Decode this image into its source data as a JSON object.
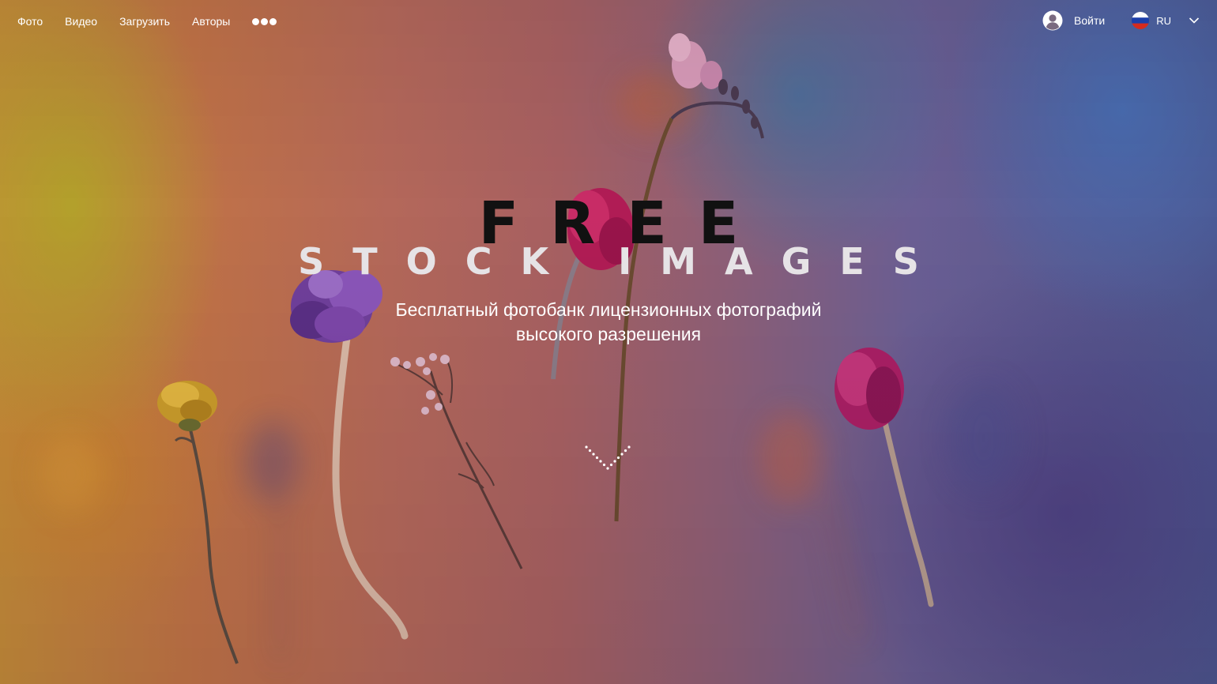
{
  "nav": {
    "links": [
      {
        "label": "Фото"
      },
      {
        "label": "Видео"
      },
      {
        "label": "Загрузить"
      },
      {
        "label": "Авторы"
      }
    ],
    "more_icon": "three-dots-icon",
    "login_label": "Войти",
    "login_icon": "user-icon",
    "language": {
      "code": "RU",
      "flag_icon": "russia-flag-icon",
      "chevron": "chevron-down-icon"
    }
  },
  "hero": {
    "title_line1": "FREE",
    "title_line2": "STOCK IMAGES",
    "subtitle_line1": "Бесплатный фотобанк лицензионных фотографий",
    "subtitle_line2": "высокого разрешения",
    "scroll_icon": "dotted-chevron-down-icon"
  },
  "colors": {
    "text": "#ffffff",
    "title_dark": "#111111",
    "title_light": "#e6e3e6",
    "flag_white": "#ffffff",
    "flag_blue": "#1c3faa",
    "flag_red": "#d52b1e"
  }
}
